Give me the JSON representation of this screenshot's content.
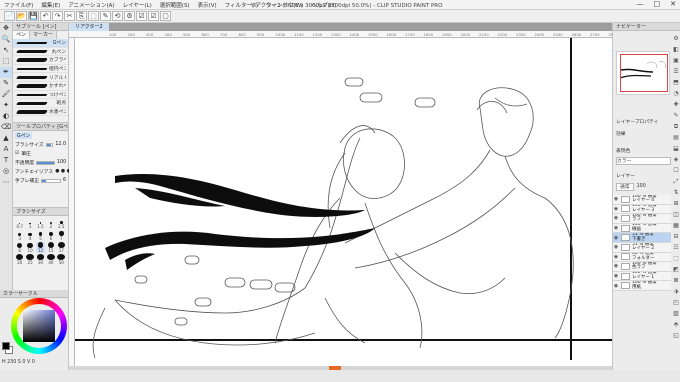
{
  "window": {
    "title": "リアクター2 (3600 x 3000px 1200dpi 50.0%) - CLIP STUDIO PAINT PRO",
    "menu": [
      "ファイル(F)",
      "編集(E)",
      "アニメーション(A)",
      "レイヤー(L)",
      "選択範囲(S)",
      "表示(V)",
      "フィルター(I)",
      "ウィンドウ(W)",
      "ヘルプ(H)"
    ],
    "controls": [
      "—",
      "□",
      "✕"
    ]
  },
  "toolbar": {
    "icons": [
      "📄",
      "📂",
      "💾",
      "↶",
      "↷",
      "✂",
      "⎘",
      "⬚",
      "✎",
      "⟲",
      "⚙",
      "☑",
      "☑",
      "▢"
    ]
  },
  "left_tools": [
    "✥",
    "🔍",
    "↖",
    "⬚",
    "✒",
    "✎",
    "🖌",
    "✦",
    "◐",
    "⌫",
    "▲",
    "A",
    "T",
    "◎",
    "⋯"
  ],
  "subtool_panel": {
    "header": "サブツール [ペン]",
    "tabs": [
      "ペン",
      "マーカー"
    ],
    "brushes": [
      "Gペン",
      "丸ペン",
      "カブラペン",
      "楷円ペン",
      "リアル Gペン",
      "かすれペン",
      "つけペン",
      "斑点",
      "水墨ペン"
    ],
    "selected_index": 0
  },
  "tool_property": {
    "header": "ツールプロパティ [Gペン]",
    "tool_name": "Gペン",
    "brush_size_label": "ブラシサイズ",
    "brush_size_value": "12.0",
    "pressure_label": "筆圧",
    "opacity_label": "不透明度",
    "opacity_value": "100",
    "antialias_label": "アンチエイリアス",
    "stabilization_label": "手ブレ補正",
    "stabilization_value": "6",
    "slider_fill": 0.7
  },
  "brush_size": {
    "header": "ブラシサイズ",
    "sizes": [
      "0.7",
      "1",
      "1.5",
      "2",
      "2.5",
      "3",
      "4",
      "5",
      "6",
      "7",
      "8",
      "10",
      "12",
      "15",
      "17",
      "20",
      "25",
      "30",
      "40",
      "50"
    ],
    "selected": "12"
  },
  "color_panel": {
    "header": "カラーサークル",
    "readout": "H 230  S 0  V 0",
    "fg": "#000000",
    "bg": "#ffffff"
  },
  "canvas": {
    "doc_tab": "リアクター2",
    "ruler_ticks": [
      "100",
      "200",
      "300",
      "400",
      "500",
      "600",
      "700",
      "800",
      "900",
      "1000",
      "1100",
      "1200",
      "1300",
      "1400",
      "1500",
      "1600",
      "1700",
      "1800",
      "1900",
      "2000",
      "2100",
      "2200",
      "2300",
      "2400",
      "2500",
      "2600",
      "2700",
      "2800"
    ]
  },
  "right_panel": {
    "nav_header": "ナビゲーター",
    "layer_prop_header": "レイヤープロパティ",
    "effect_label": "効果",
    "expression_label": "表現色",
    "expression_value": "カラー",
    "layers_header": "レイヤー",
    "blend_mode": "通常",
    "opacity": "100",
    "layers": [
      {
        "name": "100 % 通常",
        "sub": "レイヤー 4",
        "selected": false
      },
      {
        "name": "100 % 通常",
        "sub": "レイヤー 3",
        "selected": false
      },
      {
        "name": "100 % 通常",
        "sub": "ラフ",
        "selected": false
      },
      {
        "name": "100 % 通常",
        "sub": "線画",
        "selected": false
      },
      {
        "name": "51 % 通常",
        "sub": "下書き",
        "selected": true
      },
      {
        "name": "51 % 通常",
        "sub": "レイヤー 2",
        "selected": false
      },
      {
        "name": "68 % 通常",
        "sub": "フォルダー",
        "selected": false
      },
      {
        "name": "100 % 通常",
        "sub": "色ラフ",
        "selected": false
      },
      {
        "name": "100 % 通常",
        "sub": "レイヤー 1",
        "selected": false
      },
      {
        "name": "100 % 通常",
        "sub": "用紙",
        "selected": false
      }
    ]
  },
  "colors": {
    "accent": "#cfe2f6",
    "scroll_marker": "#e66a1f"
  }
}
